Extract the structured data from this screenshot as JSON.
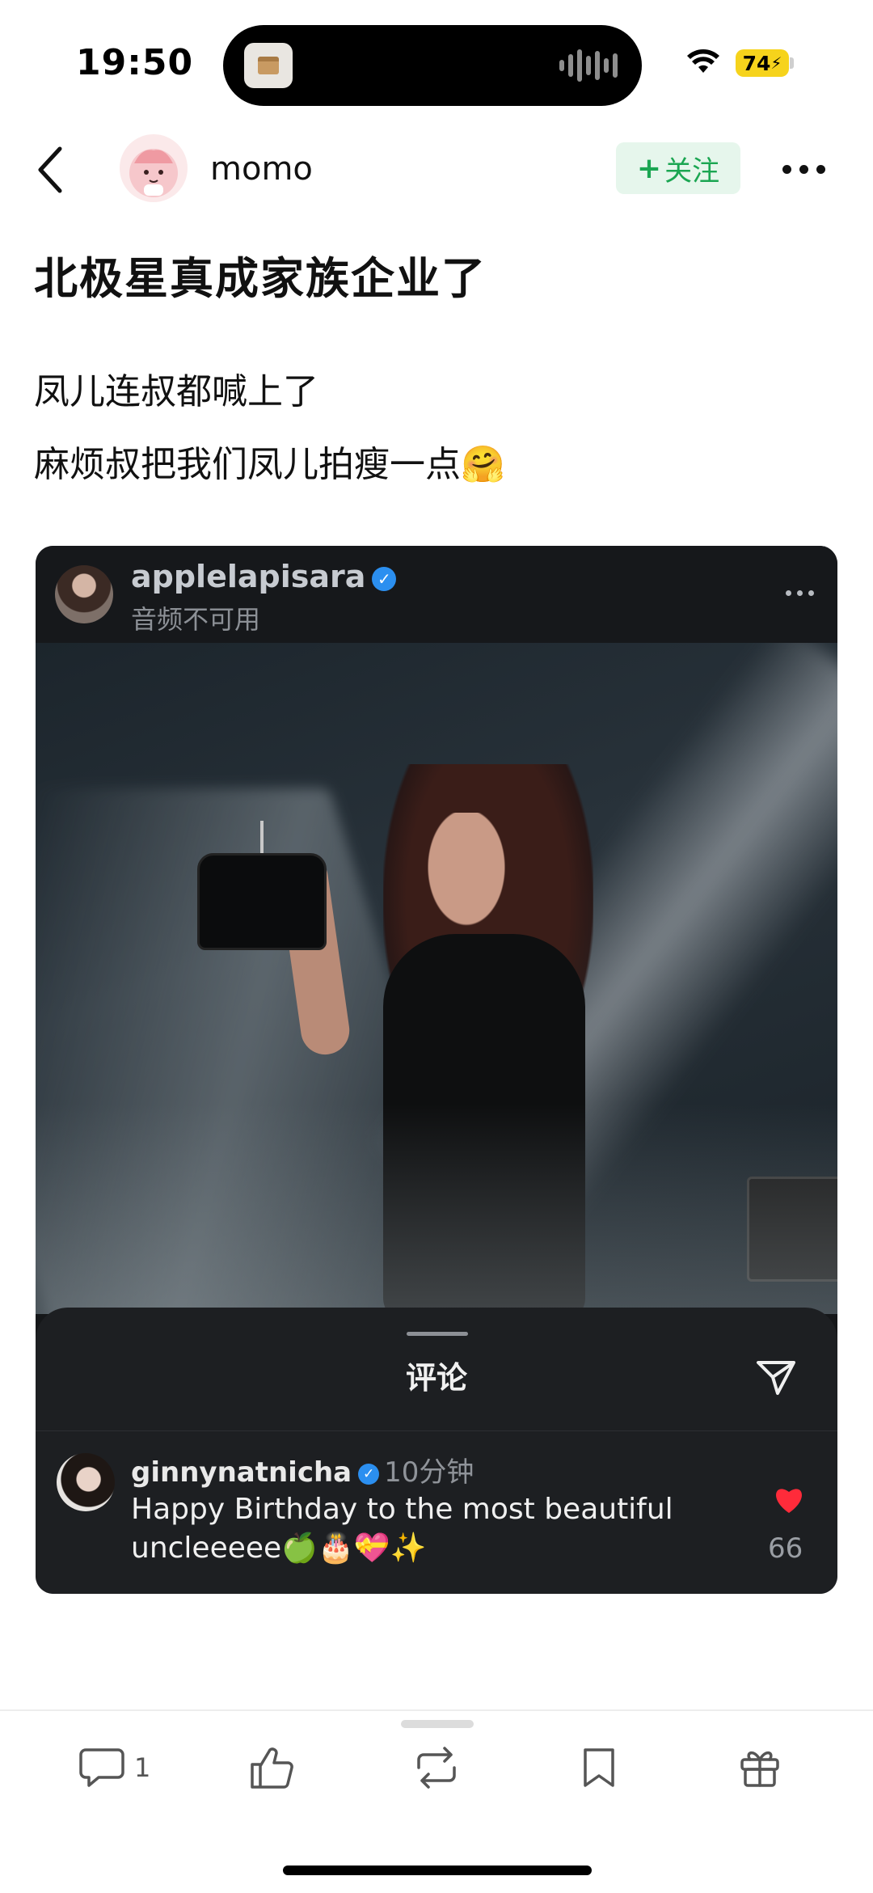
{
  "status_bar": {
    "time": "19:50",
    "battery": "74",
    "icons": [
      "wifi-icon",
      "battery-charging-icon"
    ]
  },
  "header": {
    "author_name": "momo",
    "follow_label": "关注",
    "icons": [
      "back-chevron-icon",
      "more-icon"
    ]
  },
  "post": {
    "title": "北极星真成家族企业了",
    "body_line_1": "凤儿连叔都喊上了",
    "body_line_2": "麻烦叔把我们凤儿拍瘦一点🤗"
  },
  "embedded_screenshot": {
    "username": "applelapisara",
    "subtitle": "音频不可用",
    "comments_title": "评论",
    "comment": {
      "username": "ginnynatnicha",
      "time": "10分钟",
      "text": "Happy Birthday to the most beautiful uncleeeee🍏🎂💝✨",
      "likes": "66"
    }
  },
  "action_bar": {
    "comment_count": "1",
    "icons": [
      "comment-icon",
      "like-icon",
      "repost-icon",
      "bookmark-icon",
      "gift-icon"
    ]
  },
  "colors": {
    "follow_green": "#1ba652",
    "follow_bg": "#e6f6ec",
    "battery_yellow": "#f6d31c",
    "verified_blue": "#2b8ff0",
    "heart_red": "#ff2b3a"
  }
}
